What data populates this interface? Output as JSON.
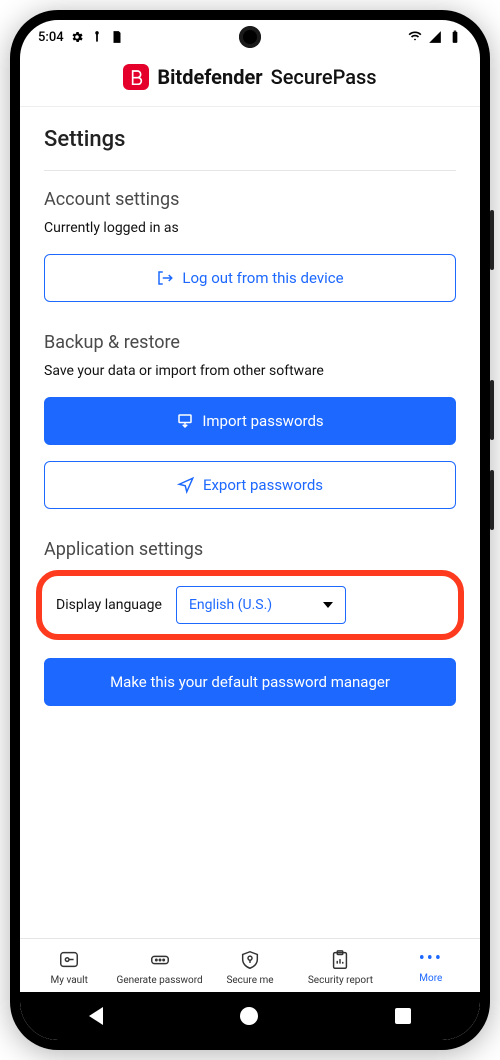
{
  "status": {
    "time": "5:04"
  },
  "header": {
    "brand": "Bitdefender",
    "product": "SecurePass"
  },
  "page": {
    "title": "Settings"
  },
  "account": {
    "title": "Account settings",
    "logged_in_as": "Currently logged in as",
    "logout_label": "Log out from this device"
  },
  "backup": {
    "title": "Backup & restore",
    "subtitle": "Save your data or import from other software",
    "import_label": "Import passwords",
    "export_label": "Export passwords"
  },
  "appsettings": {
    "title": "Application settings",
    "lang_label": "Display language",
    "lang_value": "English (U.S.)",
    "default_pm_label": "Make this your default password manager"
  },
  "tabs": {
    "vault": "My vault",
    "generate": "Generate password",
    "secure": "Secure me",
    "report": "Security report",
    "more": "More"
  }
}
